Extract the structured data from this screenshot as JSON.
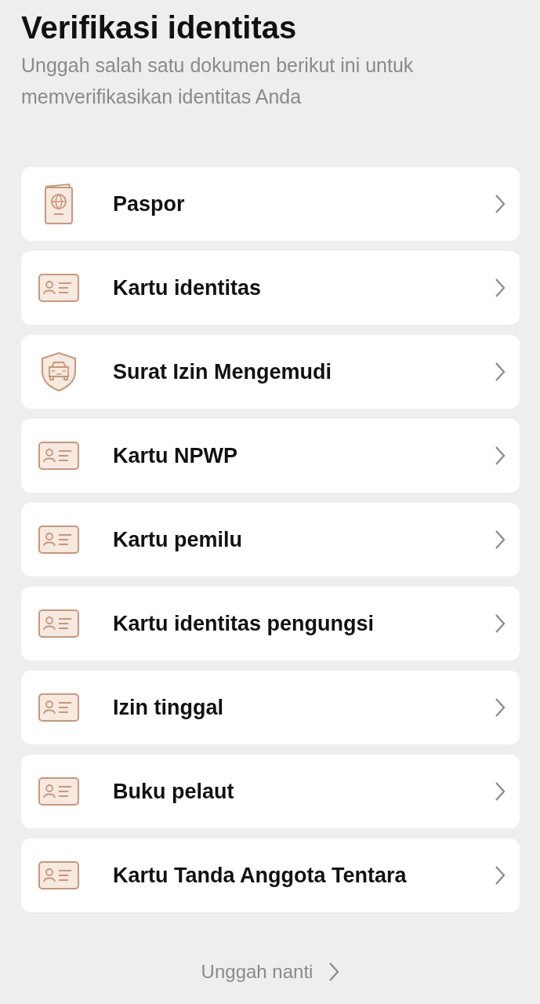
{
  "title": "Verifikasi identitas",
  "subtitle": "Unggah salah satu dokumen berikut ini untuk memverifikasikan identitas Anda",
  "documents": [
    {
      "label": "Paspor",
      "kind": "passport"
    },
    {
      "label": "Kartu identitas",
      "kind": "card"
    },
    {
      "label": "Surat Izin Mengemudi",
      "kind": "license"
    },
    {
      "label": "Kartu NPWP",
      "kind": "card"
    },
    {
      "label": "Kartu pemilu",
      "kind": "card"
    },
    {
      "label": "Kartu identitas pengungsi",
      "kind": "card"
    },
    {
      "label": "Izin tinggal",
      "kind": "card"
    },
    {
      "label": "Buku pelaut",
      "kind": "card"
    },
    {
      "label": "Kartu Tanda Anggota Tentara",
      "kind": "card"
    }
  ],
  "skip_link": "Unggah nanti"
}
